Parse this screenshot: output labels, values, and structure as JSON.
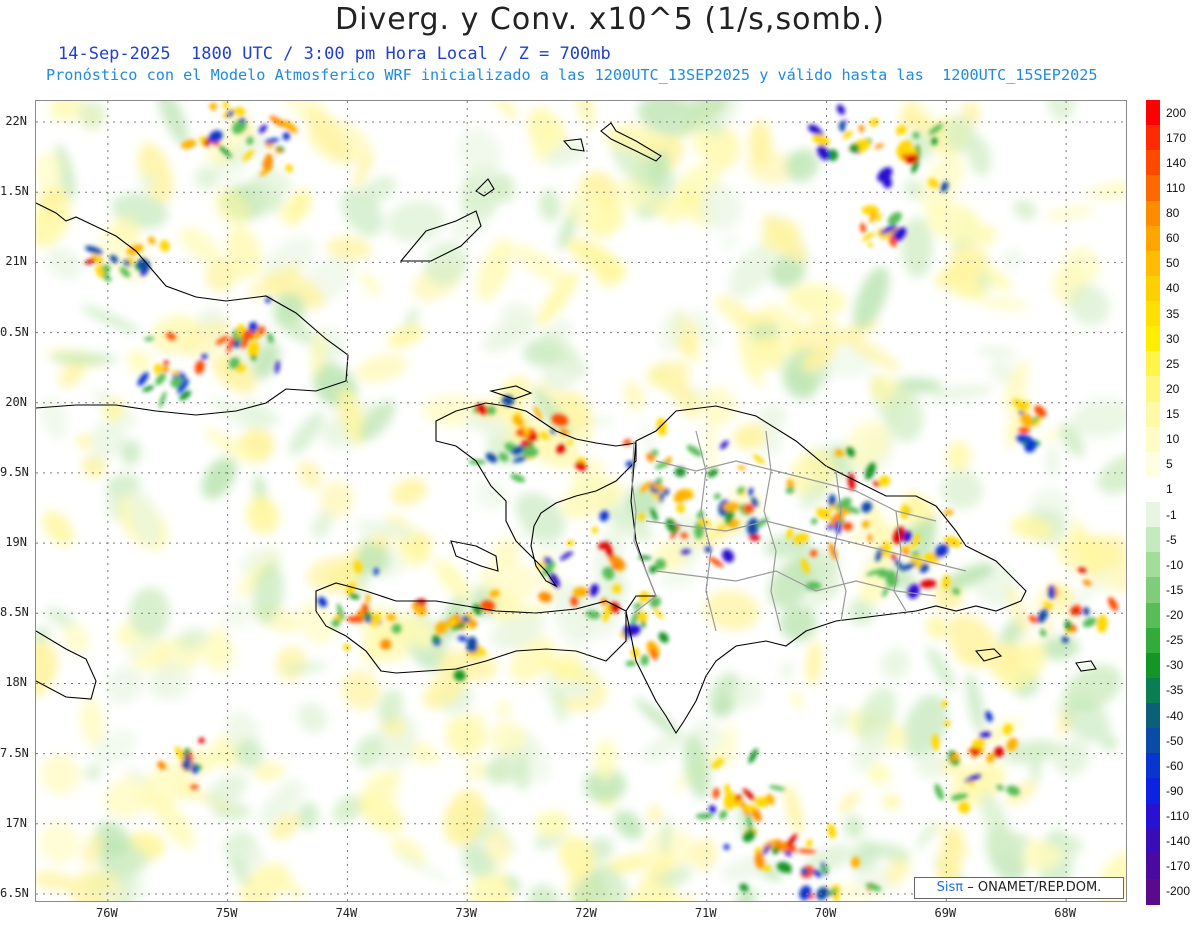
{
  "title": "Diverg. y Conv. x10^5 (1/s,somb.)",
  "subtitle_time": "14-Sep-2025  1800 UTC / 3:00 pm Hora Local / Z = 700mb",
  "subtitle_model": "Pronóstico con el Modelo Atmosferico WRF inicializado a las 1200UTC_13SEP2025 y válido hasta las  1200UTC_15SEP2025",
  "credit": {
    "brand": "Sisπ",
    "text": "– ONAMET/REP.DOM."
  },
  "axes": {
    "lat_labels": [
      "22N",
      "1.5N",
      "21N",
      "0.5N",
      "20N",
      "9.5N",
      "19N",
      "8.5N",
      "18N",
      "7.5N",
      "17N",
      "6.5N"
    ],
    "lat_values": [
      22,
      21.5,
      21,
      20.5,
      20,
      19.5,
      19,
      18.5,
      18,
      17.5,
      17,
      16.5
    ],
    "lon_labels": [
      "76W",
      "75W",
      "74W",
      "73W",
      "72W",
      "71W",
      "70W",
      "69W",
      "68W"
    ],
    "lon_values": [
      -76,
      -75,
      -74,
      -73,
      -72,
      -71,
      -70,
      -69,
      -68
    ],
    "lon_range": [
      -76.6,
      -67.5
    ],
    "lat_range": [
      16.45,
      22.15
    ]
  },
  "colorbar": {
    "labels": [
      "200",
      "170",
      "140",
      "110",
      "80",
      "60",
      "50",
      "40",
      "35",
      "30",
      "25",
      "20",
      "15",
      "10",
      "5",
      "1",
      "-1",
      "-5",
      "-10",
      "-15",
      "-20",
      "-25",
      "-30",
      "-35",
      "-40",
      "-50",
      "-60",
      "-90",
      "-110",
      "-140",
      "-170",
      "-200"
    ],
    "colors": [
      "#ff0000",
      "#ff2a00",
      "#ff4a00",
      "#ff6a00",
      "#ff8c00",
      "#ffa500",
      "#ffbc00",
      "#ffd000",
      "#ffe000",
      "#ffee00",
      "#fff44a",
      "#fff880",
      "#fffaa8",
      "#fffcc8",
      "#fffee2",
      "#ffffff",
      "#e8f5e2",
      "#c5eac0",
      "#a3dd9c",
      "#7fcd7a",
      "#58bd58",
      "#33ab3b",
      "#149528",
      "#0b7d55",
      "#0b6078",
      "#0c4aa8",
      "#0a34d0",
      "#0b22e0",
      "#2a10d0",
      "#3a0cb8",
      "#4a0aa0",
      "#5a0a8a"
    ]
  }
}
